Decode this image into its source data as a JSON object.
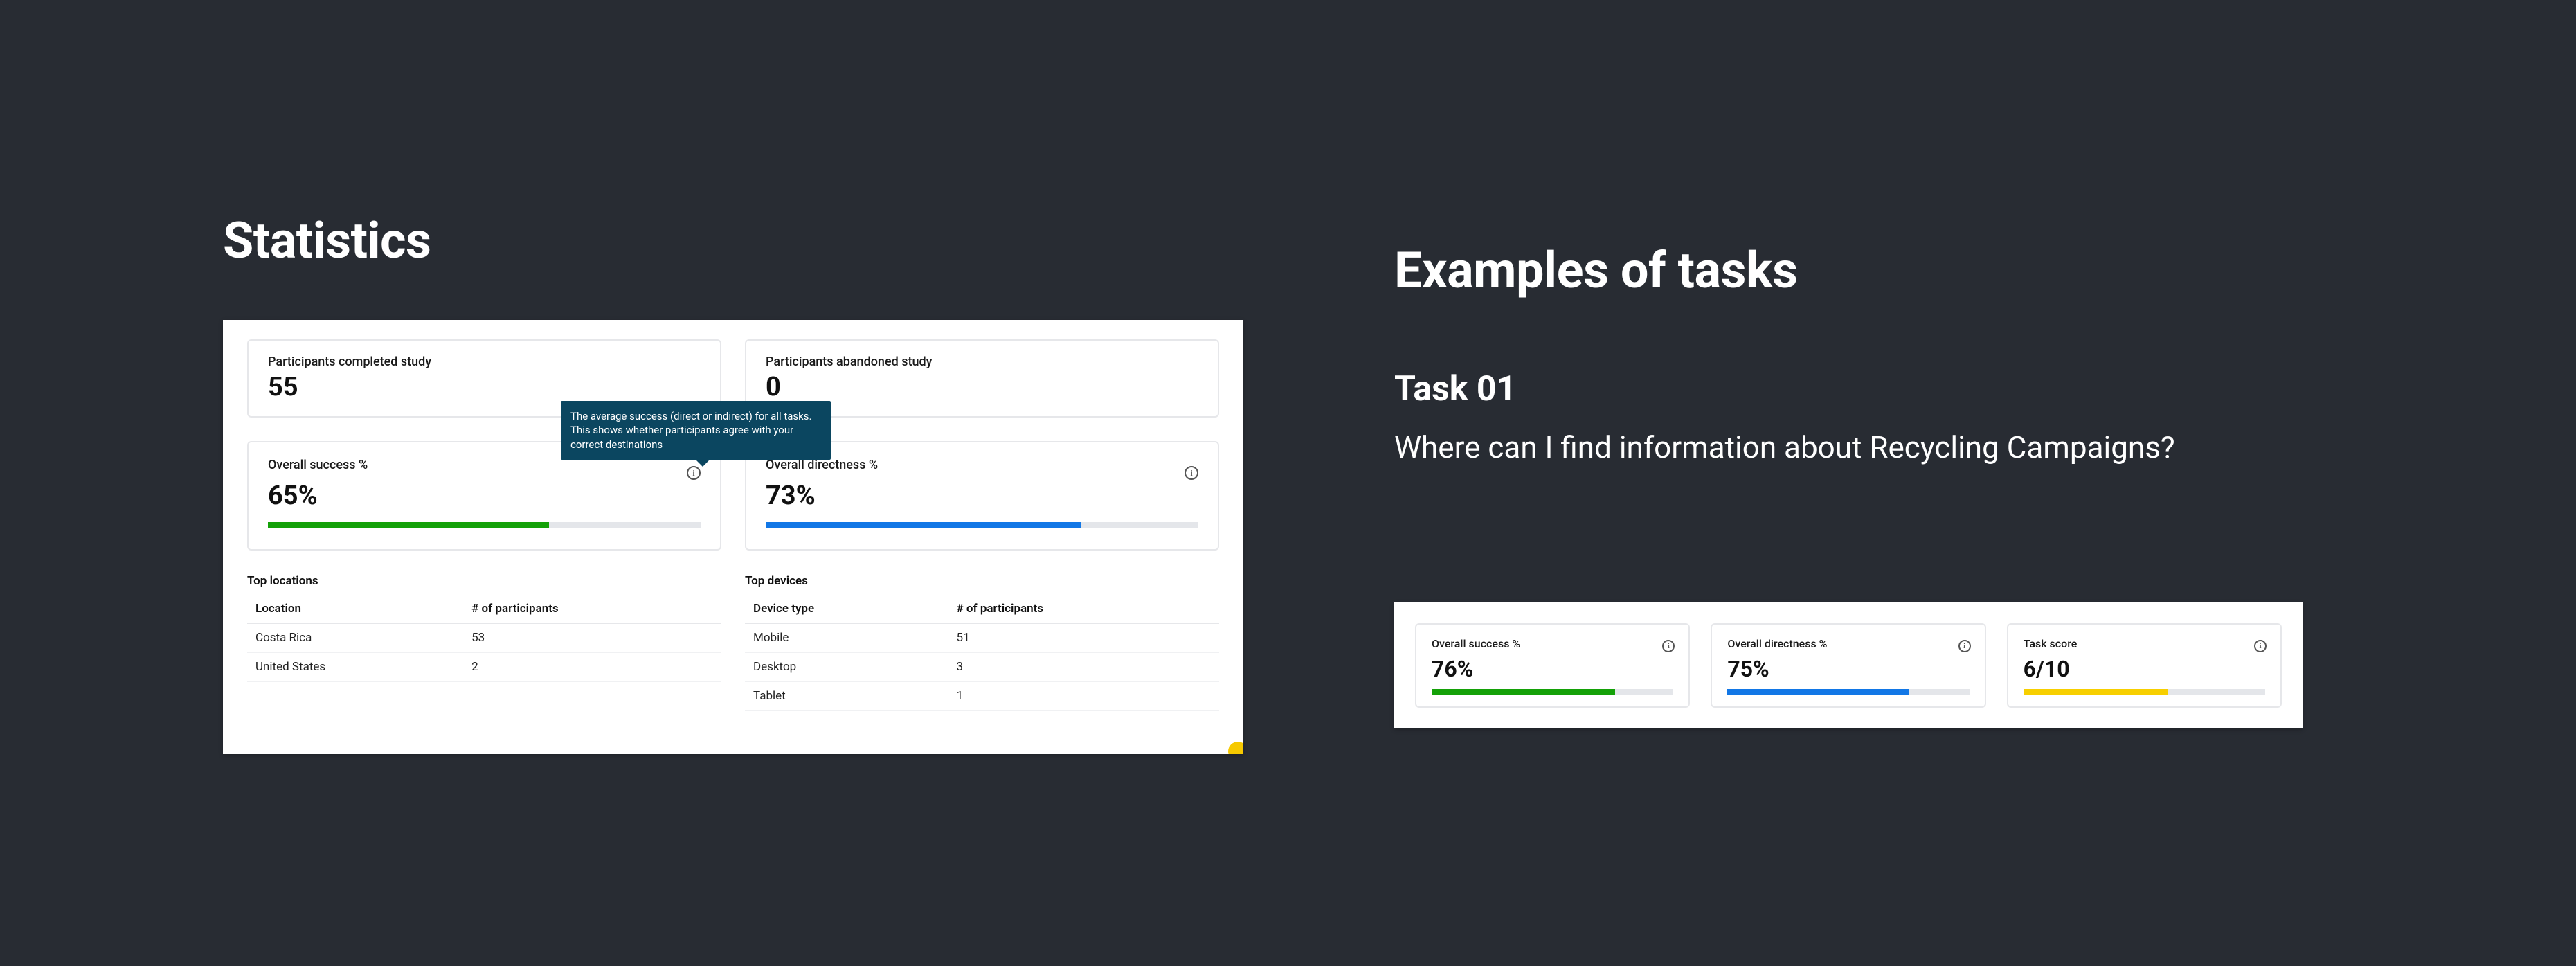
{
  "left_heading": "Statistics",
  "right_heading": "Examples of tasks",
  "task": {
    "title": "Task 01",
    "description": "Where can I find information about Recycling Campaigns?"
  },
  "tooltip_text": "The average success (direct or indirect) for all tasks. This shows whether participants agree with your correct destinations",
  "stats": {
    "completed": {
      "label": "Participants completed study",
      "value": "55"
    },
    "abandoned": {
      "label": "Participants abandoned study",
      "value": "0"
    },
    "success": {
      "label": "Overall success %",
      "value": "65%",
      "pct": 65,
      "color": "green"
    },
    "directness": {
      "label": "Overall directness %",
      "value": "73%",
      "pct": 73,
      "color": "blue"
    }
  },
  "locations": {
    "title": "Top locations",
    "headers": [
      "Location",
      "# of participants"
    ],
    "rows": [
      [
        "Costa Rica",
        "53"
      ],
      [
        "United States",
        "2"
      ]
    ]
  },
  "devices": {
    "title": "Top devices",
    "headers": [
      "Device type",
      "# of participants"
    ],
    "rows": [
      [
        "Mobile",
        "51"
      ],
      [
        "Desktop",
        "3"
      ],
      [
        "Tablet",
        "1"
      ]
    ]
  },
  "task_metrics": {
    "success": {
      "label": "Overall success %",
      "value": "76%",
      "pct": 76,
      "color": "green"
    },
    "directness": {
      "label": "Overall directness %",
      "value": "75%",
      "pct": 75,
      "color": "blue"
    },
    "score": {
      "label": "Task score",
      "value": "6/10",
      "pct": 60,
      "color": "yellow"
    }
  },
  "chart_data": [
    {
      "type": "bar",
      "title": "Overall success %",
      "categories": [
        "success"
      ],
      "values": [
        65
      ],
      "ylim": [
        0,
        100
      ]
    },
    {
      "type": "bar",
      "title": "Overall directness %",
      "categories": [
        "directness"
      ],
      "values": [
        73
      ],
      "ylim": [
        0,
        100
      ]
    },
    {
      "type": "bar",
      "title": "Task Overall success %",
      "categories": [
        "success"
      ],
      "values": [
        76
      ],
      "ylim": [
        0,
        100
      ]
    },
    {
      "type": "bar",
      "title": "Task Overall directness %",
      "categories": [
        "directness"
      ],
      "values": [
        75
      ],
      "ylim": [
        0,
        100
      ]
    },
    {
      "type": "bar",
      "title": "Task score",
      "categories": [
        "score"
      ],
      "values": [
        6
      ],
      "ylim": [
        0,
        10
      ]
    }
  ]
}
